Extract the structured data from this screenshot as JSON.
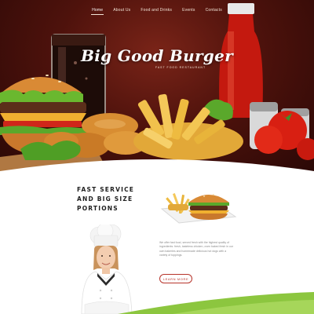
{
  "nav": {
    "items": [
      {
        "label": "Home",
        "active": true
      },
      {
        "label": "About Us",
        "active": false
      },
      {
        "label": "Food and Drinks",
        "active": false
      },
      {
        "label": "Events",
        "active": false
      },
      {
        "label": "Contacts",
        "active": false
      }
    ]
  },
  "hero": {
    "title": "Big Good Burger",
    "subtitle": "FAST FOOD RESTAURANT"
  },
  "about": {
    "title_lines": [
      "FAST SERVICE",
      "AND BIG SIZE",
      "PORTIONS"
    ],
    "description": "We offer fast food, served fresh with the highest quality of ingredients: fresh, tasteless chicken, oven baked fresh in our own bakeries and homemade delicious hot dogs with a variety of toppings.",
    "button_label": "LEARN MORE"
  },
  "colors": {
    "hero_bg": "#4e120c",
    "accent_red": "#b7342b",
    "accent_green": "#8cc63f",
    "text_dark": "#1f1f1f",
    "text_muted": "#8a8a8a"
  }
}
